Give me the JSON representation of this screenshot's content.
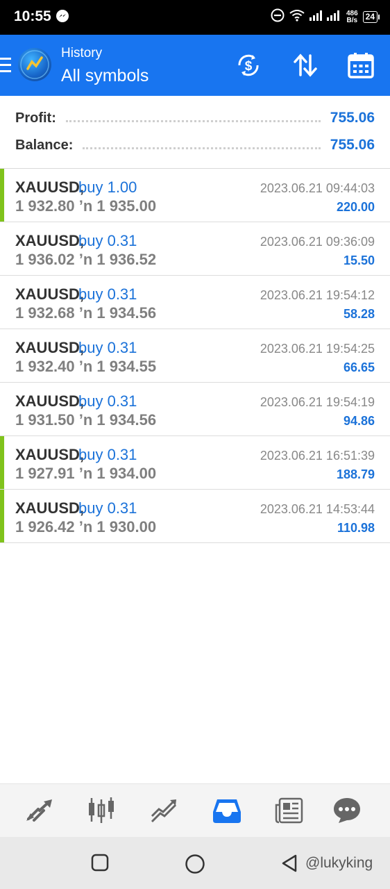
{
  "status_bar": {
    "time": "10:55",
    "net_speed_value": "486",
    "net_speed_unit": "B/s",
    "battery": "24"
  },
  "header": {
    "subtitle": "History",
    "title": "All symbols",
    "accent": "#1875f0"
  },
  "summary": {
    "profit_label": "Profit:",
    "profit_value": "755.06",
    "balance_label": "Balance:",
    "balance_value": "755.06"
  },
  "trades": [
    {
      "symbol": "XAUUSD,",
      "type": "buy 1.00",
      "prices": "1 932.80 ’n  1 935.00",
      "date": "2023.06.21 09:44:03",
      "profit": "220.00",
      "marker": true
    },
    {
      "symbol": "XAUUSD,",
      "type": "buy 0.31",
      "prices": "1 936.02 ’n  1 936.52",
      "date": "2023.06.21 09:36:09",
      "profit": "15.50",
      "marker": false
    },
    {
      "symbol": "XAUUSD,",
      "type": "buy 0.31",
      "prices": "1 932.68 ’n  1 934.56",
      "date": "2023.06.21 19:54:12",
      "profit": "58.28",
      "marker": false
    },
    {
      "symbol": "XAUUSD,",
      "type": "buy 0.31",
      "prices": "1 932.40 ’n  1 934.55",
      "date": "2023.06.21 19:54:25",
      "profit": "66.65",
      "marker": false
    },
    {
      "symbol": "XAUUSD,",
      "type": "buy 0.31",
      "prices": "1 931.50 ’n  1 934.56",
      "date": "2023.06.21 19:54:19",
      "profit": "94.86",
      "marker": false
    },
    {
      "symbol": "XAUUSD,",
      "type": "buy 0.31",
      "prices": "1 927.91 ’n  1 934.00",
      "date": "2023.06.21 16:51:39",
      "profit": "188.79",
      "marker": true
    },
    {
      "symbol": "XAUUSD,",
      "type": "buy 0.31",
      "prices": "1 926.42 ’n  1 930.00",
      "date": "2023.06.21 14:53:44",
      "profit": "110.98",
      "marker": true
    }
  ],
  "bottom_nav": {
    "items": [
      "quotes-icon",
      "chart-icon",
      "trade-icon",
      "history-icon",
      "news-icon",
      "chat-icon"
    ],
    "active": "history-icon",
    "active_color": "#1875f0"
  },
  "watermark": "@lukyking"
}
